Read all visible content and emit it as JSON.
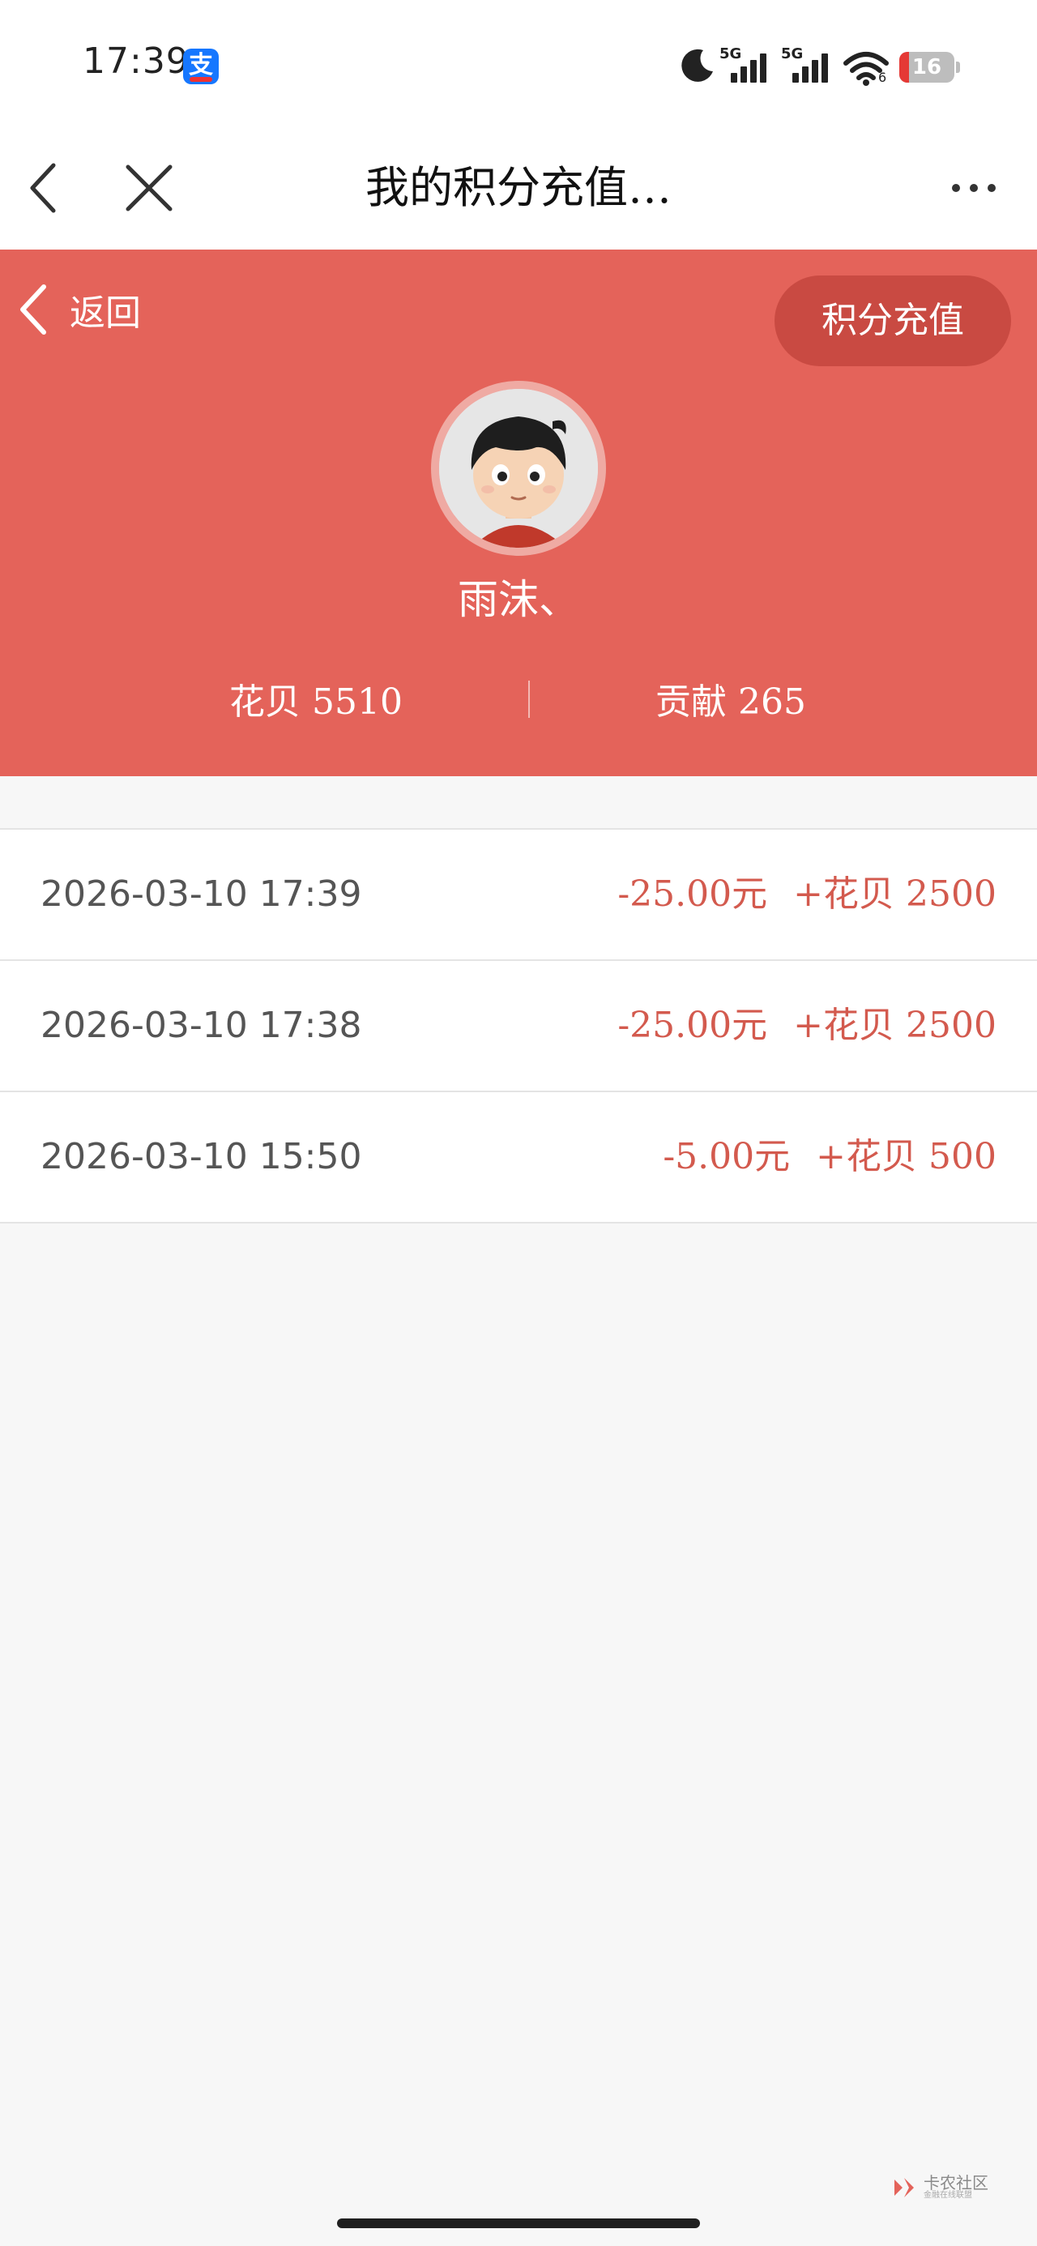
{
  "status_bar": {
    "time": "17:39",
    "app_badge": "支",
    "network_1": "5G",
    "network_2": "5G",
    "wifi_level": "6",
    "battery": "16"
  },
  "nav": {
    "title": "我的积分充值…"
  },
  "header": {
    "back_label": "返回",
    "recharge_button": "积分充值",
    "username": "雨沫、",
    "stats": {
      "huabei": "花贝 5510",
      "contribution": "贡献 265"
    },
    "accent_color": "#e4635a"
  },
  "records": [
    {
      "datetime": "2026-03-10 17:39",
      "amount": "-25.00元",
      "points": "+花贝 2500"
    },
    {
      "datetime": "2026-03-10 17:38",
      "amount": "-25.00元",
      "points": "+花贝 2500"
    },
    {
      "datetime": "2026-03-10 15:50",
      "amount": "-5.00元",
      "points": "+花贝 500"
    }
  ],
  "watermark": {
    "name": "卡农社区",
    "sub": "金融在线联盟"
  }
}
